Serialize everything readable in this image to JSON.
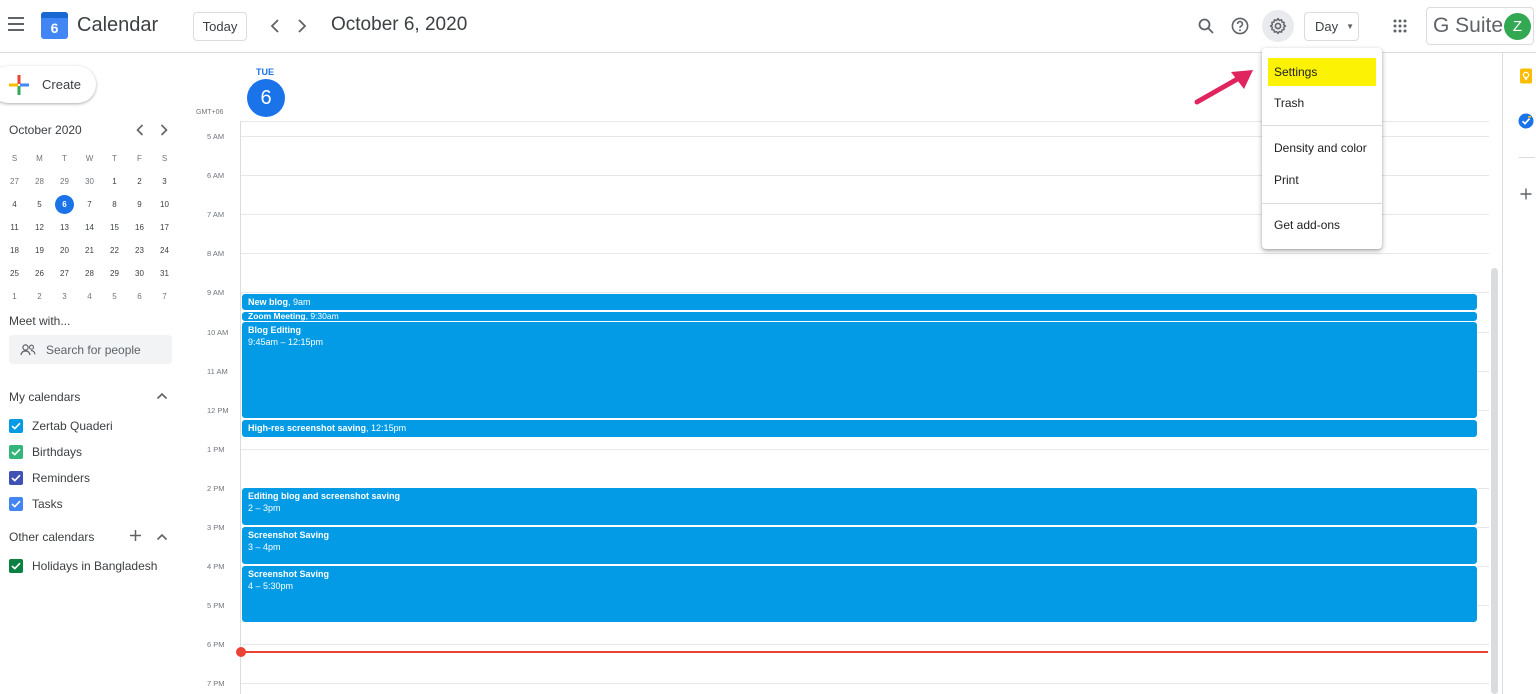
{
  "header": {
    "app_title": "Calendar",
    "logo_number": "6",
    "today_label": "Today",
    "prev_icon": "chevron-left-icon",
    "next_icon": "chevron-right-icon",
    "date_title": "October 6, 2020",
    "view_label": "Day",
    "brand": "G Suite",
    "avatar_letter": "Z"
  },
  "sidebar": {
    "create_label": "Create",
    "mini_month_title": "October 2020",
    "weekdays": [
      "S",
      "M",
      "T",
      "W",
      "T",
      "F",
      "S"
    ],
    "weeks": [
      [
        "27",
        "28",
        "29",
        "30",
        "1",
        "2",
        "3"
      ],
      [
        "4",
        "5",
        "6",
        "7",
        "8",
        "9",
        "10"
      ],
      [
        "11",
        "12",
        "13",
        "14",
        "15",
        "16",
        "17"
      ],
      [
        "18",
        "19",
        "20",
        "21",
        "22",
        "23",
        "24"
      ],
      [
        "25",
        "26",
        "27",
        "28",
        "29",
        "30",
        "31"
      ],
      [
        "1",
        "2",
        "3",
        "4",
        "5",
        "6",
        "7"
      ]
    ],
    "meet_with": "Meet with...",
    "search_placeholder": "Search for people",
    "my_calendars_title": "My calendars",
    "my_calendars": [
      {
        "label": "Zertab Quaderi",
        "color": "#039be5"
      },
      {
        "label": "Birthdays",
        "color": "#33b679"
      },
      {
        "label": "Reminders",
        "color": "#3f51b5"
      },
      {
        "label": "Tasks",
        "color": "#4285f4"
      }
    ],
    "other_calendars_title": "Other calendars",
    "other_calendars": [
      {
        "label": "Holidays in Bangladesh",
        "color": "#0b8043"
      }
    ]
  },
  "day_view": {
    "day_name": "TUE",
    "day_number": "6",
    "timezone": "GMT+06",
    "hours": [
      "5 AM",
      "6 AM",
      "7 AM",
      "8 AM",
      "9 AM",
      "10 AM",
      "11 AM",
      "12 PM",
      "1 PM",
      "2 PM",
      "3 PM",
      "4 PM",
      "5 PM",
      "6 PM",
      "7 PM"
    ],
    "events": [
      {
        "title": "New blog",
        "time": ", 9am"
      },
      {
        "title": "Zoom Meeting",
        "time": ", 9:30am"
      },
      {
        "title": "Blog Editing",
        "time": "9:45am – 12:15pm"
      },
      {
        "title": "High-res screenshot saving",
        "time": ", 12:15pm"
      },
      {
        "title": "Editing blog and screenshot saving",
        "time": "2 – 3pm"
      },
      {
        "title": "Screenshot Saving",
        "time": "3 – 4pm"
      },
      {
        "title": "Screenshot Saving",
        "time": "4 – 5:30pm"
      }
    ],
    "event_color": "#039be5"
  },
  "settings_menu": {
    "items": [
      "Settings",
      "Trash",
      "Density and color",
      "Print",
      "Get add-ons"
    ],
    "highlight_color": "#fbf204"
  }
}
